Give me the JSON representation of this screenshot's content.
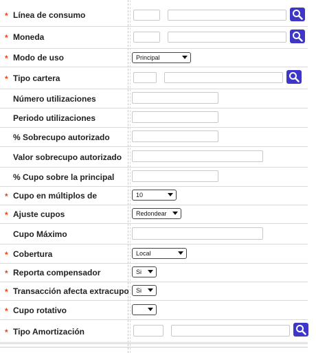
{
  "colors": {
    "required": "#e0461b",
    "search_button": "#3d36c6"
  },
  "required_marker": "*",
  "fields": [
    {
      "label": "Línea de consumo"
    },
    {
      "label": "Moneda"
    },
    {
      "label": "Modo de uso",
      "value": "Principal"
    },
    {
      "label": "Tipo cartera"
    },
    {
      "label": "Número utilizaciones"
    },
    {
      "label": "Periodo utilizaciones"
    },
    {
      "label": "% Sobrecupo autorizado"
    },
    {
      "label": "Valor sobrecupo autorizado"
    },
    {
      "label": "% Cupo sobre la principal"
    },
    {
      "label": "Cupo en múltiplos de",
      "value": "10"
    },
    {
      "label": "Ajuste cupos",
      "value": "Redondear"
    },
    {
      "label": "Cupo Máximo"
    },
    {
      "label": "Cobertura",
      "value": "Local"
    },
    {
      "label": "Reporta compensador",
      "value": "Si"
    },
    {
      "label": "Transacción afecta extracupo",
      "value": "Si"
    },
    {
      "label": "Cupo rotativo",
      "value": ""
    },
    {
      "label": "Tipo Amortización"
    }
  ],
  "icons": {
    "search": "magnifier-icon"
  }
}
